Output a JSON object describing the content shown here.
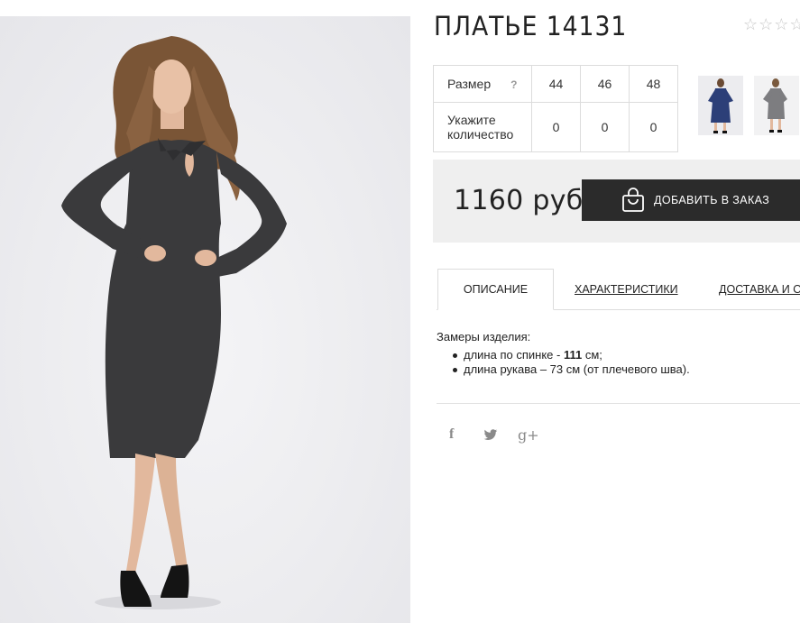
{
  "product": {
    "title": "ПЛАТЬЕ 14131",
    "rating_stars": 5,
    "rating_filled": 0
  },
  "size_table": {
    "size_label": "Размер",
    "help_mark": "?",
    "sizes": [
      "44",
      "46",
      "48"
    ],
    "qty_label": "Укажите количество",
    "quantities": [
      "0",
      "0",
      "0"
    ]
  },
  "purchase": {
    "price": "1160 руб",
    "add_button": "ДОБАВИТЬ В ЗАКАЗ",
    "button_color": "#2b2b2b"
  },
  "tabs": [
    {
      "label": "ОПИСАНИЕ",
      "active": true
    },
    {
      "label": "ХАРАКТЕРИСТИКИ",
      "active": false
    },
    {
      "label": "ДОСТАВКА И ОП",
      "active": false
    }
  ],
  "description": {
    "heading": "Замеры изделия:",
    "items": [
      {
        "prefix": "длина по спинке - ",
        "bold": "111",
        "suffix": " см;"
      },
      {
        "prefix": "длина рукава – 73 см (от плечевого шва).",
        "bold": "",
        "suffix": ""
      }
    ]
  },
  "social": {
    "icons": [
      "facebook-icon",
      "twitter-icon",
      "google-plus-icon"
    ],
    "facebook_glyph": "f",
    "google_glyph": "g+"
  }
}
